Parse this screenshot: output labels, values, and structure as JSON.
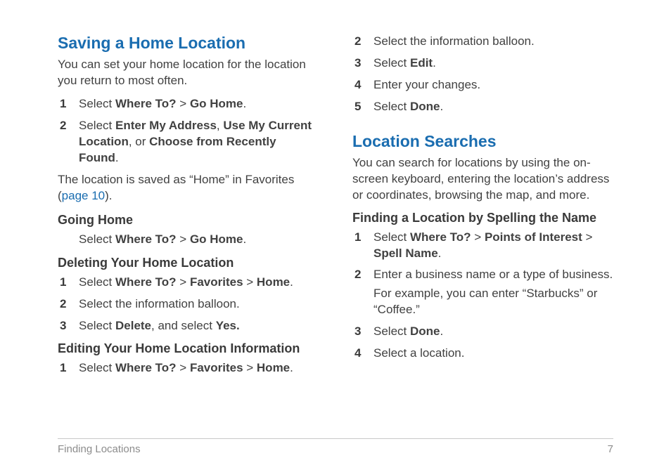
{
  "col1": {
    "saving": {
      "title": "Saving a Home Location",
      "intro": "You can set your home location for the location you return to most often.",
      "step1_a": "Select ",
      "step1_b": "Where To?",
      "step1_c": " > ",
      "step1_d": "Go Home",
      "step1_e": ".",
      "step2_a": "Select ",
      "step2_b": "Enter My Address",
      "step2_c": ", ",
      "step2_d": "Use My Current Location",
      "step2_e": ", or ",
      "step2_f": "Choose from Recently Found",
      "step2_g": ".",
      "note_a": "The location is saved as “Home” in Favorites (",
      "note_link": "page 10",
      "note_b": ")."
    },
    "going": {
      "title": "Going Home",
      "line_a": "Select ",
      "line_b": "Where To?",
      "line_c": " > ",
      "line_d": "Go Home",
      "line_e": "."
    },
    "deleting": {
      "title": "Deleting Your Home Location",
      "s1_a": "Select ",
      "s1_b": "Where To?",
      "s1_c": " > ",
      "s1_d": "Favorites",
      "s1_e": " > ",
      "s1_f": "Home",
      "s1_g": ".",
      "s2": "Select the information balloon.",
      "s3_a": "Select ",
      "s3_b": "Delete",
      "s3_c": ", and select ",
      "s3_d": "Yes."
    },
    "editing": {
      "title": "Editing Your Home Location Information",
      "s1_a": "Select ",
      "s1_b": "Where To?",
      "s1_c": " > ",
      "s1_d": "Favorites",
      "s1_e": " > ",
      "s1_f": "Home",
      "s1_g": "."
    }
  },
  "col2": {
    "editing_cont": {
      "s2": "Select the information balloon.",
      "s3_a": "Select ",
      "s3_b": "Edit",
      "s3_c": ".",
      "s4": "Enter your changes.",
      "s5_a": "Select ",
      "s5_b": "Done",
      "s5_c": "."
    },
    "searches": {
      "title": "Location Searches",
      "intro": "You can search for locations by using the on-screen keyboard, entering the location’s address or coordinates, browsing the map, and more."
    },
    "finding": {
      "title": "Finding a Location by Spelling the Name",
      "s1_a": "Select ",
      "s1_b": "Where To?",
      "s1_c": " > ",
      "s1_d": "Points of Interest",
      "s1_e": " > ",
      "s1_f": "Spell Name",
      "s1_g": ".",
      "s2": "Enter a business name or a type of business.",
      "s2_extra": "For example, you can enter “Starbucks” or “Coffee.”",
      "s3_a": "Select ",
      "s3_b": "Done",
      "s3_c": ".",
      "s4": "Select a location."
    }
  },
  "footer": {
    "left": "Finding Locations",
    "right": "7"
  }
}
